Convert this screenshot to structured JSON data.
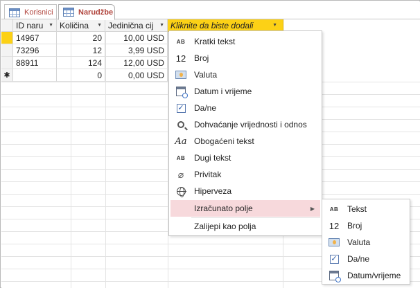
{
  "tabs": [
    {
      "label": "Korisnici",
      "active": false
    },
    {
      "label": "Narudžbe",
      "active": true
    }
  ],
  "datasheet": {
    "columns": [
      "ID naru",
      "Količina",
      "Jedinična cij",
      "Kliknite da biste dodali"
    ],
    "rows": [
      {
        "selector": "",
        "id": "14967",
        "qty": "20",
        "price": "10,00 USD"
      },
      {
        "selector": "",
        "id": "73296",
        "qty": "12",
        "price": "3,99 USD"
      },
      {
        "selector": "",
        "id": "88911",
        "qty": "124",
        "price": "12,00 USD"
      },
      {
        "selector": "✱",
        "id": "",
        "qty": "0",
        "price": "0,00 USD"
      }
    ]
  },
  "menu": {
    "items": [
      {
        "label": "Kratki tekst",
        "icon": "short-text-icon",
        "icon_text": "AB"
      },
      {
        "label": "Broj",
        "icon": "number-icon",
        "icon_text": "12"
      },
      {
        "label": "Valuta",
        "icon": "currency-icon"
      },
      {
        "label": "Datum i vrijeme",
        "icon": "date-time-icon"
      },
      {
        "label": "Da/ne",
        "icon": "yes-no-checkbox-icon"
      },
      {
        "label": "Dohvaćanje vrijednosti i odnos",
        "icon": "lookup-icon"
      },
      {
        "label": "Obogaćeni tekst",
        "icon": "rich-text-icon",
        "icon_text": "Aa"
      },
      {
        "label": "Dugi tekst",
        "icon": "long-text-icon",
        "icon_text": "AB"
      },
      {
        "label": "Privitak",
        "icon": "attachment-icon"
      },
      {
        "label": "Hiperveza",
        "icon": "hyperlink-icon"
      },
      {
        "label": "Izračunato polje",
        "icon": "none",
        "highlighted": true
      },
      {
        "label": "Zalijepi kao polja",
        "icon": "none"
      }
    ]
  },
  "submenu": {
    "items": [
      {
        "label": "Tekst",
        "icon": "text-icon",
        "icon_text": "AB"
      },
      {
        "label": "Broj",
        "icon": "number-icon",
        "icon_text": "12"
      },
      {
        "label": "Valuta",
        "icon": "currency-icon"
      },
      {
        "label": "Da/ne",
        "icon": "yes-no-checkbox-icon"
      },
      {
        "label": "Datum/vrijeme",
        "icon": "date-time-icon"
      }
    ]
  },
  "colors": {
    "add_column_header": "#fcd116",
    "menu_highlight": "#f7d9dc",
    "tab_text": "#b0433b"
  }
}
